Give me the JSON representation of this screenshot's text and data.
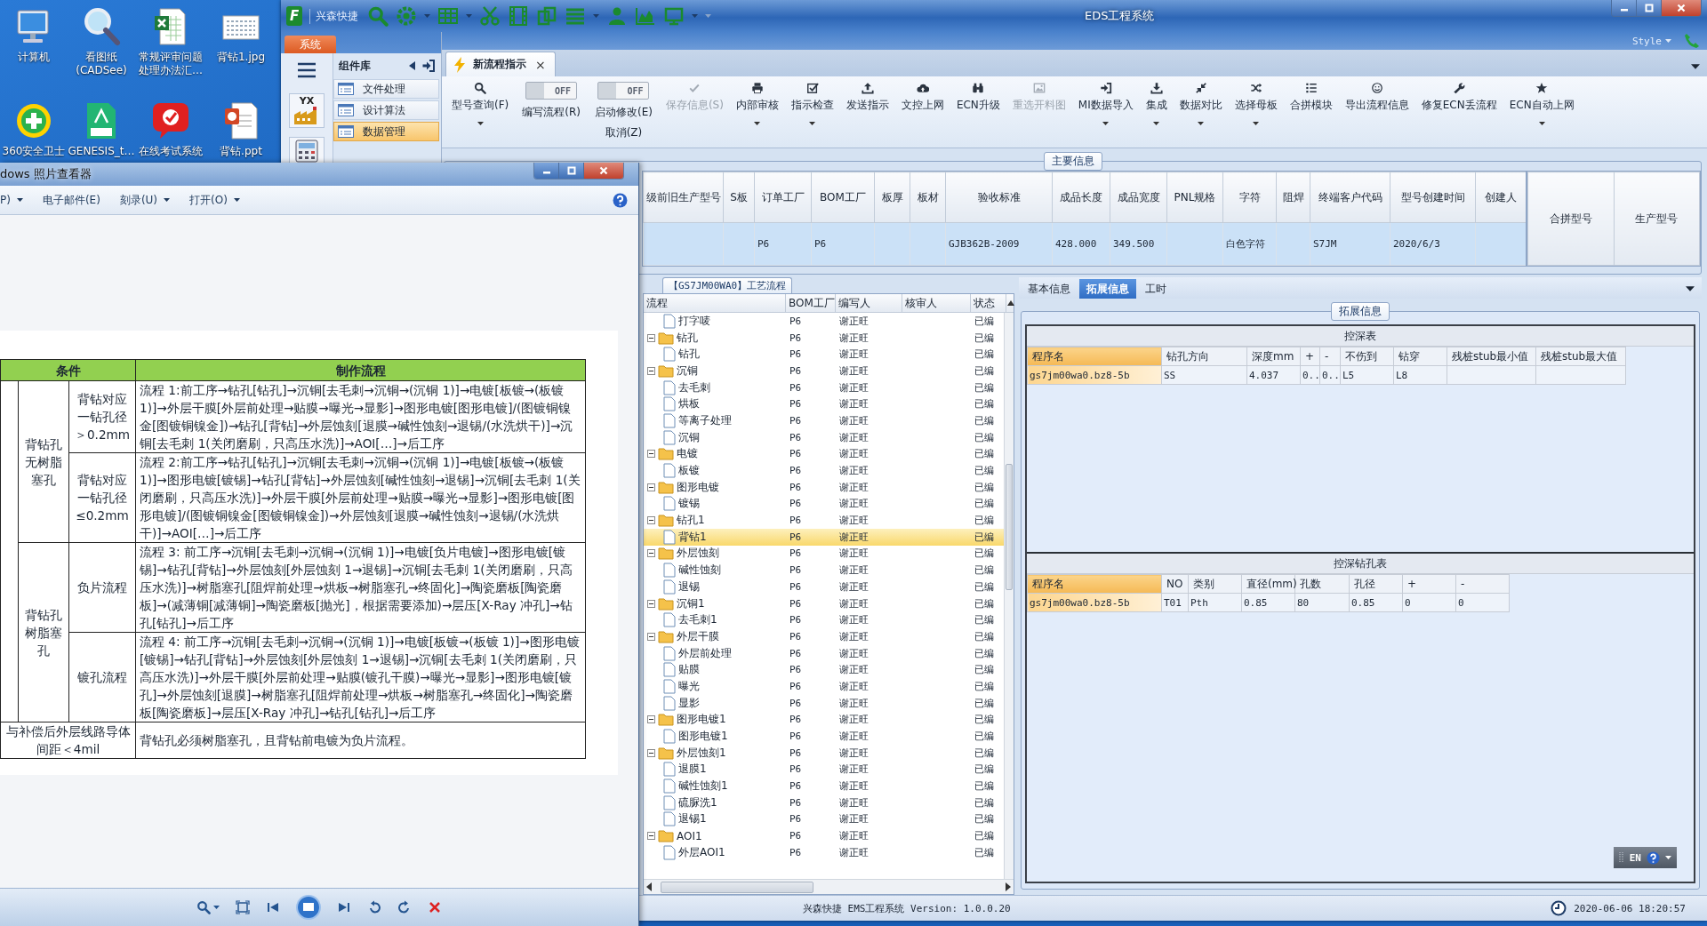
{
  "desktop": {
    "icons": [
      {
        "label": "计算机"
      },
      {
        "label": "看图纸 (CADSee)"
      },
      {
        "label": "常规评审问题处理办法汇…"
      },
      {
        "label": "背钻1.jpg"
      },
      {
        "label": "360安全卫士"
      },
      {
        "label": "GENESIS_t…"
      },
      {
        "label": "在线考试系统"
      },
      {
        "label": "背钻.ppt"
      }
    ]
  },
  "app": {
    "logo": "F",
    "brand": "兴森快捷",
    "title": "EDS工程系统",
    "style_label": "Style",
    "system_tab": "系统",
    "nav_badge": "YX",
    "component_library": {
      "title": "组件库",
      "items": [
        {
          "label": "文件处理",
          "selected": false
        },
        {
          "label": "设计算法",
          "selected": false
        },
        {
          "label": "数据管理",
          "selected": true
        }
      ]
    },
    "doc_tabs": [
      {
        "label": "新流程指示",
        "close": "×",
        "selected": true
      }
    ],
    "ribbon": [
      {
        "kind": "button",
        "label": "型号查询(F)",
        "dropdown": true,
        "disabled": false
      },
      {
        "kind": "toggle",
        "state": "OFF",
        "on": false,
        "label": "编写流程(R)"
      },
      {
        "kind": "toggle",
        "state": "OFF",
        "on": false,
        "label": "启动修改(E)",
        "sub_label": "取消(Z)"
      },
      {
        "kind": "button",
        "label": "保存信息(S)",
        "dropdown": false,
        "disabled": true
      },
      {
        "kind": "button",
        "label": "内部审核",
        "dropdown": true,
        "disabled": false
      },
      {
        "kind": "button",
        "label": "指示检查",
        "dropdown": true,
        "disabled": false
      },
      {
        "kind": "button",
        "label": "发送指示",
        "dropdown": false,
        "disabled": false
      },
      {
        "kind": "button",
        "label": "文控上网",
        "dropdown": false,
        "disabled": false
      },
      {
        "kind": "button",
        "label": "ECN升级",
        "dropdown": false,
        "disabled": false
      },
      {
        "kind": "button",
        "label": "重选开料图",
        "dropdown": false,
        "disabled": true
      },
      {
        "kind": "button",
        "label": "MI数据导入",
        "dropdown": true,
        "disabled": false
      },
      {
        "kind": "button",
        "label": "集成",
        "dropdown": true,
        "disabled": false
      },
      {
        "kind": "button",
        "label": "数据对比",
        "dropdown": true,
        "disabled": false
      },
      {
        "kind": "button",
        "label": "选择母板",
        "dropdown": true,
        "disabled": false
      },
      {
        "kind": "button",
        "label": "合拼模块",
        "dropdown": false,
        "disabled": false
      },
      {
        "kind": "button",
        "label": "导出流程信息",
        "dropdown": false,
        "disabled": false
      },
      {
        "kind": "button",
        "label": "修复ECN丢流程",
        "dropdown": false,
        "disabled": false
      },
      {
        "kind": "button",
        "label": "ECN自动上网",
        "dropdown": true,
        "disabled": false
      }
    ],
    "main_info": {
      "title": "主要信息",
      "columns": [
        "级前旧生产型号",
        "S板",
        "订单工厂",
        "BOM工厂",
        "板厚",
        "板材",
        "验收标准",
        "成品长度",
        "成品宽度",
        "PNL规格",
        "字符",
        "阻焊",
        "终端客户代码",
        "型号创建时间",
        "创建人"
      ],
      "rows": [
        {
          "selected": true,
          "cells": [
            null,
            null,
            "P6",
            "P6",
            null,
            null,
            "GJB362B-2009",
            "428.000",
            "349.500",
            null,
            "白色字符",
            null,
            "S7JM",
            "2020/6/3",
            null
          ]
        }
      ],
      "side_columns": [
        "合拼型号",
        "生产型号"
      ]
    },
    "process_tree": {
      "title": "【GS7JM00WA0】工艺流程",
      "columns": [
        "流程",
        "BOM工厂",
        "编写人",
        "核审人",
        "状态"
      ],
      "nodes": [
        {
          "kind": "file",
          "label": "打字唛",
          "bom": "P6",
          "writer": "谢正旺",
          "status": "已编",
          "selected": false
        },
        {
          "kind": "folder",
          "label": "钻孔",
          "bom": "P6",
          "writer": "谢正旺",
          "status": "已编",
          "selected": false,
          "expanded": true,
          "children": [
            {
              "kind": "file",
              "label": "钻孔",
              "bom": "P6",
              "writer": "谢正旺",
              "status": "已编",
              "selected": false
            }
          ]
        },
        {
          "kind": "folder",
          "label": "沉铜",
          "bom": "P6",
          "writer": "谢正旺",
          "status": "已编",
          "selected": false,
          "expanded": true,
          "children": [
            {
              "kind": "file",
              "label": "去毛刺",
              "bom": "P6",
              "writer": "谢正旺",
              "status": "已编",
              "selected": false
            },
            {
              "kind": "file",
              "label": "烘板",
              "bom": "P6",
              "writer": "谢正旺",
              "status": "已编",
              "selected": false
            },
            {
              "kind": "file",
              "label": "等离子处理",
              "bom": "P6",
              "writer": "谢正旺",
              "status": "已编",
              "selected": false
            },
            {
              "kind": "file",
              "label": "沉铜",
              "bom": "P6",
              "writer": "谢正旺",
              "status": "已编",
              "selected": false
            }
          ]
        },
        {
          "kind": "folder",
          "label": "电镀",
          "bom": "P6",
          "writer": "谢正旺",
          "status": "已编",
          "selected": false,
          "expanded": true,
          "children": [
            {
              "kind": "file",
              "label": "板镀",
              "bom": "P6",
              "writer": "谢正旺",
              "status": "已编",
              "selected": false
            }
          ]
        },
        {
          "kind": "folder",
          "label": "图形电镀",
          "bom": "P6",
          "writer": "谢正旺",
          "status": "已编",
          "selected": false,
          "expanded": true,
          "children": [
            {
              "kind": "file",
              "label": "镀锡",
              "bom": "P6",
              "writer": "谢正旺",
              "status": "已编",
              "selected": false
            }
          ]
        },
        {
          "kind": "folder",
          "label": "钻孔1",
          "bom": "P6",
          "writer": "谢正旺",
          "status": "已编",
          "selected": false,
          "expanded": true,
          "children": [
            {
              "kind": "file",
              "label": "背钻1",
              "bom": "P6",
              "writer": "谢正旺",
              "status": "已编",
              "selected": true
            }
          ]
        },
        {
          "kind": "folder",
          "label": "外层蚀刻",
          "bom": "P6",
          "writer": "谢正旺",
          "status": "已编",
          "selected": false,
          "expanded": true,
          "children": [
            {
              "kind": "file",
              "label": "碱性蚀刻",
              "bom": "P6",
              "writer": "谢正旺",
              "status": "已编",
              "selected": false
            },
            {
              "kind": "file",
              "label": "退锡",
              "bom": "P6",
              "writer": "谢正旺",
              "status": "已编",
              "selected": false
            }
          ]
        },
        {
          "kind": "folder",
          "label": "沉铜1",
          "bom": "P6",
          "writer": "谢正旺",
          "status": "已编",
          "selected": false,
          "expanded": true,
          "children": [
            {
              "kind": "file",
              "label": "去毛刺1",
              "bom": "P6",
              "writer": "谢正旺",
              "status": "已编",
              "selected": false
            }
          ]
        },
        {
          "kind": "folder",
          "label": "外层干膜",
          "bom": "P6",
          "writer": "谢正旺",
          "status": "已编",
          "selected": false,
          "expanded": true,
          "children": [
            {
              "kind": "file",
              "label": "外层前处理",
              "bom": "P6",
              "writer": "谢正旺",
              "status": "已编",
              "selected": false
            },
            {
              "kind": "file",
              "label": "贴膜",
              "bom": "P6",
              "writer": "谢正旺",
              "status": "已编",
              "selected": false
            },
            {
              "kind": "file",
              "label": "曝光",
              "bom": "P6",
              "writer": "谢正旺",
              "status": "已编",
              "selected": false
            },
            {
              "kind": "file",
              "label": "显影",
              "bom": "P6",
              "writer": "谢正旺",
              "status": "已编",
              "selected": false
            }
          ]
        },
        {
          "kind": "folder",
          "label": "图形电镀1",
          "bom": "P6",
          "writer": "谢正旺",
          "status": "已编",
          "selected": false,
          "expanded": true,
          "children": [
            {
              "kind": "file",
              "label": "图形电镀1",
              "bom": "P6",
              "writer": "谢正旺",
              "status": "已编",
              "selected": false
            }
          ]
        },
        {
          "kind": "folder",
          "label": "外层蚀刻1",
          "bom": "P6",
          "writer": "谢正旺",
          "status": "已编",
          "selected": false,
          "expanded": true,
          "children": [
            {
              "kind": "file",
              "label": "退膜1",
              "bom": "P6",
              "writer": "谢正旺",
              "status": "已编",
              "selected": false
            },
            {
              "kind": "file",
              "label": "碱性蚀刻1",
              "bom": "P6",
              "writer": "谢正旺",
              "status": "已编",
              "selected": false
            },
            {
              "kind": "file",
              "label": "硫脲洗1",
              "bom": "P6",
              "writer": "谢正旺",
              "status": "已编",
              "selected": false
            },
            {
              "kind": "file",
              "label": "退锡1",
              "bom": "P6",
              "writer": "谢正旺",
              "status": "已编",
              "selected": false
            }
          ]
        },
        {
          "kind": "folder",
          "label": "AOI1",
          "bom": "P6",
          "writer": "谢正旺",
          "status": "已编",
          "selected": false,
          "expanded": true,
          "children": [
            {
              "kind": "file",
              "label": "外层AOI1",
              "bom": "P6",
              "writer": "谢正旺",
              "status": "已编",
              "selected": false
            }
          ]
        }
      ]
    },
    "detail": {
      "tabs": [
        {
          "label": "基本信息",
          "selected": false
        },
        {
          "label": "拓展信息",
          "selected": true
        },
        {
          "label": "工时",
          "selected": false
        }
      ],
      "group_title": "拓展信息",
      "tables": [
        {
          "title": "控深表",
          "columns": [
            "程序名",
            "钻孔方向",
            "深度mm",
            "+",
            "-",
            "不伤到",
            "钻穿",
            "残桩stub最小值",
            "残桩stub最大值"
          ],
          "rows": [
            [
              "gs7jm00wa0.bz8-5b",
              "SS",
              "4.037",
              "0..",
              "0..",
              "L5",
              "L8",
              null,
              null
            ]
          ]
        },
        {
          "title": "控深钻孔表",
          "columns": [
            "程序名",
            "NO",
            "类别",
            "直径(mm)",
            "孔数",
            "孔径",
            "+",
            "-"
          ],
          "rows": [
            [
              "gs7jm00wa0.bz8-5b",
              "T01",
              "Pth",
              "0.85",
              "80",
              "0.85",
              "0",
              "0"
            ]
          ]
        }
      ]
    },
    "ime": {
      "label": "EN"
    },
    "status_bar": {
      "version": "兴森快捷 EMS工程系统 Version: 1.0.0.20",
      "datetime": "2020-06-06 18:20:57"
    }
  },
  "photo_viewer": {
    "title": "dows 照片查看器",
    "menu": [
      {
        "label": "P)",
        "dropdown": true
      },
      {
        "label": "电子邮件(E)",
        "dropdown": false
      },
      {
        "label": "刻录(U)",
        "dropdown": true
      },
      {
        "label": "打开(O)",
        "dropdown": true
      }
    ],
    "document": {
      "headers": [
        "条件",
        "制作流程"
      ],
      "groups": [
        {
          "label": "背钻孔无树脂塞孔",
          "cases": [
            {
              "condition": "背钻对应一钻孔径＞0.2mm",
              "flow": "流程 1:前工序→钻孔[钻孔]→沉铜[去毛刺→沉铜→(沉铜 1)]→电镀[板镀→(板镀 1)]→外层干膜[外层前处理→贴膜→曝光→显影]→图形电镀[图形电镀]/(图镀铜镍金[图镀铜镍金])→钻孔[背钻]→外层蚀刻[退膜→碱性蚀刻→退锡/(水洗烘干)]→沉铜[去毛刺 1(关闭磨刷，只高压水洗)]→AOI[…]→后工序"
            },
            {
              "condition": "背钻对应一钻孔径≤0.2mm",
              "flow": "流程 2:前工序→钻孔[钻孔]→沉铜[去毛刺→沉铜→(沉铜 1)]→电镀[板镀→(板镀 1)]→图形电镀[镀锡]→钻孔[背钻]→外层蚀刻[碱性蚀刻→退锡]→沉铜[去毛刺 1(关闭磨刷，只高压水洗)]→外层干膜[外层前处理→贴膜→曝光→显影]→图形电镀[图形电镀]/(图镀铜镍金[图镀铜镍金])→外层蚀刻[退膜→碱性蚀刻→退锡/(水洗烘干)]→AOI[…]→后工序"
            }
          ]
        },
        {
          "label": "背钻孔树脂塞孔",
          "cases": [
            {
              "condition": "负片流程",
              "flow": "流程 3: 前工序→沉铜[去毛刺→沉铜→(沉铜 1)]→电镀[负片电镀]→图形电镀[镀锡]→钻孔[背钻]→外层蚀刻[外层蚀刻 1→退锡]→沉铜[去毛刺 1(关闭磨刷，只高压水洗)]→树脂塞孔[阻焊前处理→烘板→树脂塞孔→终固化]→陶瓷磨板[陶瓷磨板]→(减薄铜[减薄铜]→陶瓷磨板[抛光]，根据需要添加)→层压[X-Ray 冲孔]→钻孔[钻孔]→后工序"
            },
            {
              "condition": "镀孔流程",
              "flow": "流程 4: 前工序→沉铜[去毛刺→沉铜→(沉铜 1)]→电镀[板镀→(板镀 1)]→图形电镀[镀锡]→钻孔[背钻]→外层蚀刻[外层蚀刻 1→退锡]→沉铜[去毛刺 1(关闭磨刷，只高压水洗)]→外层干膜[外层前处理→贴膜(镀孔干膜)→曝光→显影]→图形电镀[镀孔]→外层蚀刻[退膜]→树脂塞孔[阻焊前处理→烘板→树脂塞孔→终固化]→陶瓷磨板[陶瓷磨板]→层压[X-Ray 冲孔]→钻孔[钻孔]→后工序"
            }
          ]
        }
      ],
      "note": {
        "condition": "与补偿后外层线路导体间距＜4mil",
        "flow": "背钻孔必须树脂塞孔，且背钻前电镀为负片流程。"
      }
    }
  }
}
